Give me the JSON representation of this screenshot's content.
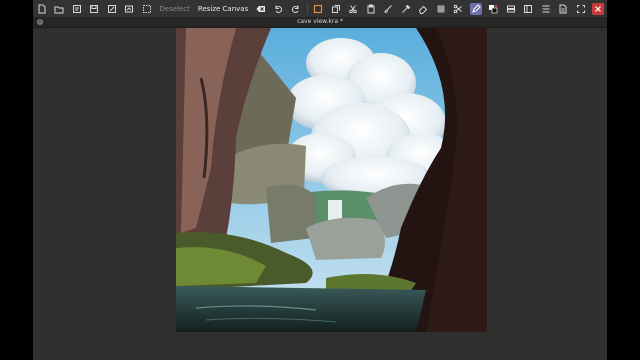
{
  "toolbar": {
    "deselect_label": "Deselect",
    "resize_canvas_label": "Resize Canvas"
  },
  "document": {
    "tab_title": "cave view.kra *"
  },
  "colors": {
    "background": "#2f2f2f",
    "toolbar": "#333333",
    "active_tool": "#6d6fa8",
    "close_button": "#c83a3a"
  }
}
